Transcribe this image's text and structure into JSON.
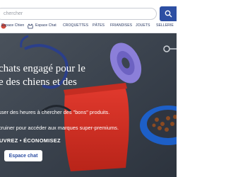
{
  "search": {
    "placeholder": "chercher"
  },
  "nav": {
    "items": [
      {
        "label": "Espace Chien"
      },
      {
        "label": "Espace Chat"
      },
      {
        "label": "CROQUETTES"
      },
      {
        "label": "PÂTES"
      },
      {
        "label": "FRIANDISES"
      },
      {
        "label": "JOUETS"
      },
      {
        "label": "SELLERIE"
      }
    ]
  },
  "hero": {
    "headline_line1": "chats engagé pour le",
    "headline_line2": "e des chiens et des",
    "subtext_line1": "sser des heures à chercher des \"bons\" produits.",
    "subtext_line2": "cruiner pour accéder aux marques super-premiums.",
    "cta_text": "UVREZ • ÉCONOMISEZ",
    "button_label": "Espace chat"
  },
  "colors": {
    "brand_blue": "#2d4fa3",
    "nav_text": "#2b3a63",
    "hero_text": "#ffffff"
  }
}
